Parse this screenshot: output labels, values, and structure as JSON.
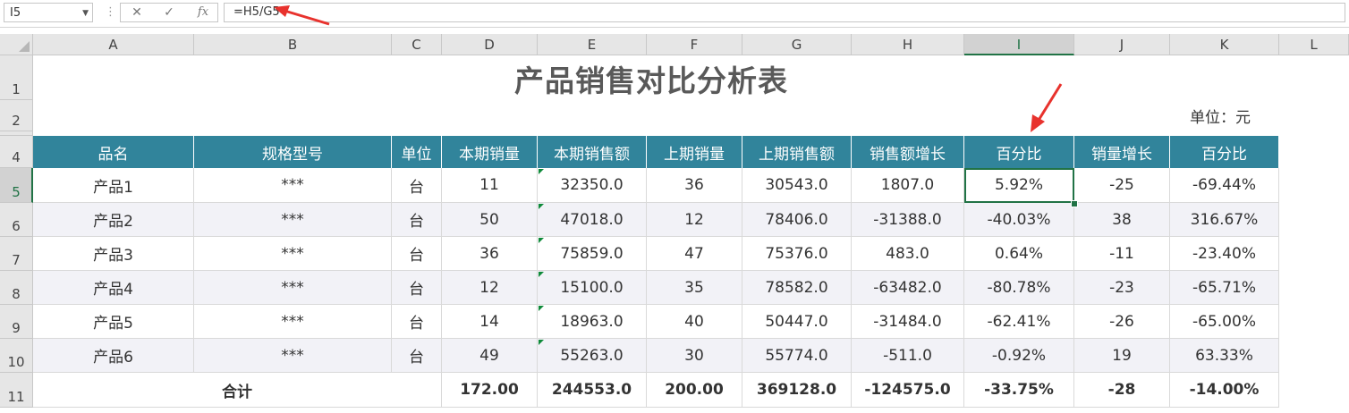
{
  "formula_bar": {
    "name_box": "I5",
    "fx_label": "fx",
    "cancel_icon": "✕",
    "enter_icon": "✓",
    "formula": "=H5/G5"
  },
  "columns": [
    "A",
    "B",
    "C",
    "D",
    "E",
    "F",
    "G",
    "H",
    "I",
    "J",
    "K",
    "L"
  ],
  "rows": [
    "1",
    "2",
    "",
    "4",
    "5",
    "6",
    "7",
    "8",
    "9",
    "10",
    "11"
  ],
  "sheet": {
    "title": "产品销售对比分析表",
    "unit": "单位：元",
    "headers": [
      "品名",
      "规格型号",
      "单位",
      "本期销量",
      "本期销售额",
      "上期销量",
      "上期销售额",
      "销售额增长",
      "百分比",
      "销量增长",
      "百分比"
    ],
    "rows": [
      [
        "产品1",
        "***",
        "台",
        "11",
        "32350.0",
        "36",
        "30543.0",
        "1807.0",
        "5.92%",
        "-25",
        "-69.44%"
      ],
      [
        "产品2",
        "***",
        "台",
        "50",
        "47018.0",
        "12",
        "78406.0",
        "-31388.0",
        "-40.03%",
        "38",
        "316.67%"
      ],
      [
        "产品3",
        "***",
        "台",
        "36",
        "75859.0",
        "47",
        "75376.0",
        "483.0",
        "0.64%",
        "-11",
        "-23.40%"
      ],
      [
        "产品4",
        "***",
        "台",
        "12",
        "15100.0",
        "35",
        "78582.0",
        "-63482.0",
        "-80.78%",
        "-23",
        "-65.71%"
      ],
      [
        "产品5",
        "***",
        "台",
        "14",
        "18963.0",
        "40",
        "50447.0",
        "-31484.0",
        "-62.41%",
        "-26",
        "-65.00%"
      ],
      [
        "产品6",
        "***",
        "台",
        "49",
        "55263.0",
        "30",
        "55774.0",
        "-511.0",
        "-0.92%",
        "19",
        "63.33%"
      ]
    ],
    "total": {
      "label": "合计",
      "values": [
        "172.00",
        "244553.0",
        "200.00",
        "369128.0",
        "-124575.0",
        "-33.75%",
        "-28",
        "-14.00%"
      ]
    }
  },
  "colors": {
    "header_bg": "#31849b",
    "header_text": "#ffffff",
    "stripe_bg": "#f2f2f7",
    "selection": "#217346",
    "annotation_arrow": "#e8322d"
  }
}
